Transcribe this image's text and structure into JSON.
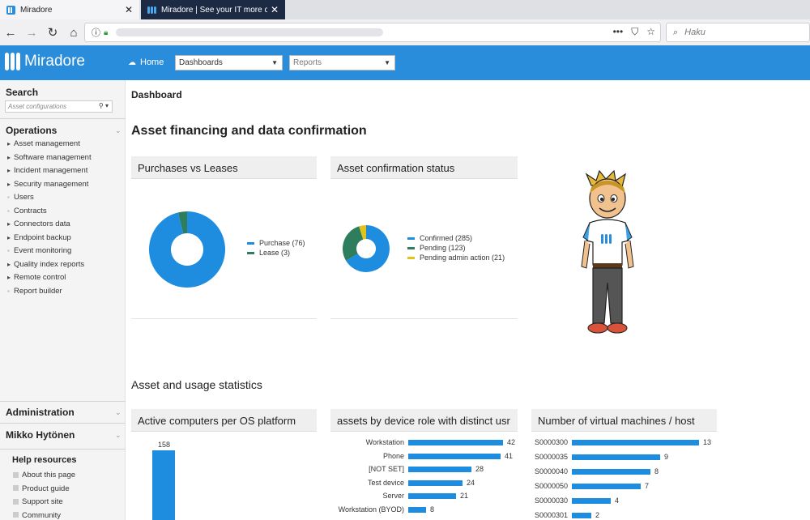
{
  "browser": {
    "tabs": [
      {
        "title": "Miradore",
        "active": true
      },
      {
        "title": "Miradore | See your IT more cl",
        "active": false
      }
    ],
    "search_placeholder": "Haku"
  },
  "app": {
    "logo_text": "Miradore",
    "home_label": "Home",
    "dashboards_select": "Dashboards",
    "reports_select": "Reports"
  },
  "sidebar": {
    "search_title": "Search",
    "search_placeholder": "Asset configurations",
    "operations_title": "Operations",
    "operations_items": [
      "Asset management",
      "Software management",
      "Incident management",
      "Security management",
      "Users",
      "Contracts",
      "Connectors data",
      "Endpoint backup",
      "Event monitoring",
      "Quality index reports",
      "Remote control",
      "Report builder"
    ],
    "administration_title": "Administration",
    "user_name": "Mikko Hytönen",
    "help_title": "Help resources",
    "help_items": [
      "About this page",
      "Product guide",
      "Support site",
      "Community"
    ]
  },
  "main": {
    "breadcrumb": "Dashboard",
    "section1_title": "Asset financing and data confirmation",
    "section2_title": "Asset and usage statistics",
    "panels": {
      "purchases": "Purchases vs Leases",
      "confirmation": "Asset confirmation status",
      "os": "Active computers per OS platform",
      "roles": "assets by device role with distinct usr",
      "vms": "Number of virtual machines / host"
    }
  },
  "colors": {
    "blue": "#1e8ddf",
    "green": "#2e7d5c",
    "yellow": "#e2c31a",
    "appbar": "#2a8ddb"
  },
  "chart_data": [
    {
      "type": "pie",
      "title": "Purchases vs Leases",
      "labels": [
        "Purchase (76)",
        "Lease (3)"
      ],
      "values": [
        76,
        3
      ],
      "colors": [
        "#1e8ddf",
        "#2e7d5c"
      ],
      "donut": true
    },
    {
      "type": "pie",
      "title": "Asset confirmation status",
      "labels": [
        "Confirmed (285)",
        "Pending (123)",
        "Pending admin action (21)"
      ],
      "values": [
        285,
        123,
        21
      ],
      "colors": [
        "#1e8ddf",
        "#2e7d5c",
        "#e2c31a"
      ],
      "donut": true
    },
    {
      "type": "bar",
      "title": "Active computers per OS platform",
      "series": [
        {
          "values": [
            158
          ]
        }
      ]
    },
    {
      "type": "bar",
      "orientation": "horizontal",
      "title": "assets by device role with distinct usr",
      "categories": [
        "Workstation",
        "Phone",
        "[NOT SET]",
        "Test device",
        "Server",
        "Workstation (BYOD)"
      ],
      "values": [
        42,
        41,
        28,
        24,
        21,
        8
      ],
      "xlim": [
        0,
        42
      ]
    },
    {
      "type": "bar",
      "orientation": "horizontal",
      "title": "Number of virtual machines / host",
      "categories": [
        "S0000300",
        "S0000035",
        "S0000040",
        "S0000050",
        "S0000030",
        "S0000301"
      ],
      "values": [
        13,
        9,
        8,
        7,
        4,
        2
      ],
      "xlim": [
        0,
        13
      ]
    }
  ]
}
